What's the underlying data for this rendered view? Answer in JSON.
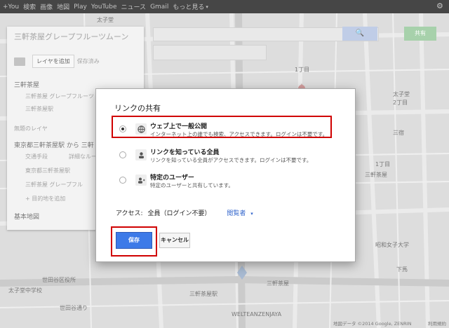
{
  "gbar": {
    "links": [
      "+You",
      "検索",
      "画像",
      "地図",
      "Play",
      "YouTube",
      "ニュース",
      "Gmail",
      "もっと見る"
    ],
    "more_caret": "▾",
    "settings_icon": "gear-icon"
  },
  "panel": {
    "title": "三軒茶屋グレープフルーツムーン",
    "add_layer": "レイヤを追加",
    "saved": "保存済み",
    "layer1_title": "三軒茶屋",
    "layer1_items": [
      "三軒茶屋 グレープフルーツ",
      "三軒茶屋駅"
    ],
    "untitled_layer": "無題のレイヤ",
    "route_title": "東京都三軒茶屋駅 から 三軒",
    "route_mode": "交通手段",
    "route_detail": "詳細なルート",
    "route_points": [
      "東京都三軒茶屋駅",
      "三軒茶屋 グレープフル"
    ],
    "add_destination": "+ 目的地を追加",
    "base_map": "基本地図"
  },
  "map": {
    "share_label": "共有",
    "labels": [
      "太子堂",
      "1丁目",
      "太子堂",
      "2丁目",
      "1丁目",
      "三軒茶屋",
      "三軒茶屋",
      "昭和女子大学",
      "世田谷通り",
      "三軒茶屋駅",
      "三宿",
      "太子堂中学校",
      "下馬",
      "WELTEANZENJAYA",
      "世田谷区役所",
      "地図データ ©2014 Google, ZENRIN",
      "利用規約"
    ]
  },
  "dialog": {
    "title": "リンクの共有",
    "options": [
      {
        "title": "ウェブ上で一般公開",
        "desc": "インターネット上の誰でも検索、アクセスできます。ログインは不要です。",
        "icon": "globe-icon",
        "selected": true
      },
      {
        "title": "リンクを知っている全員",
        "desc": "リンクを知っている全員がアクセスできます。ログインは不要です。",
        "icon": "people-icon",
        "selected": false
      },
      {
        "title": "特定のユーザー",
        "desc": "特定のユーザーと共有しています。",
        "icon": "person-icon",
        "selected": false
      }
    ],
    "access_label": "アクセス:",
    "access_value": "全員（ログイン不要）",
    "role": "閲覧者",
    "role_caret": "▾",
    "save": "保存",
    "cancel": "キャンセル"
  },
  "colors": {
    "highlight": "#d00000",
    "save_button": "#3d7ae8",
    "role_link": "#3366cc"
  }
}
